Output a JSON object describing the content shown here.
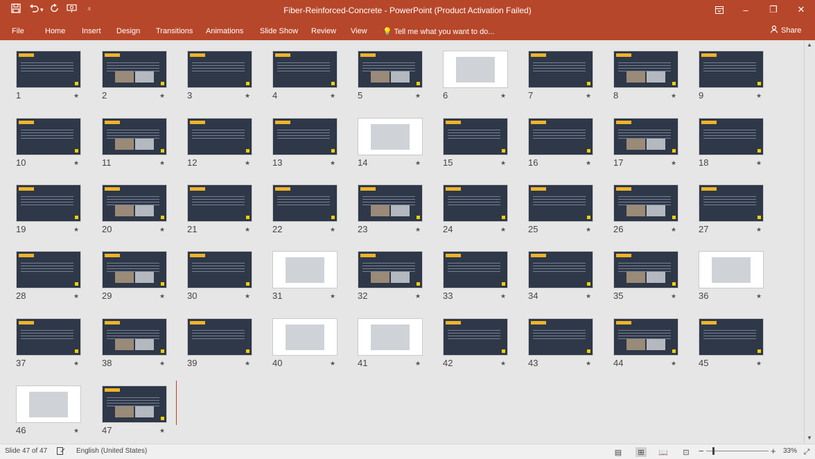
{
  "app": {
    "window_title": "Fiber-Reinforced-Concrete - PowerPoint (Product Activation Failed)",
    "colors": {
      "ribbon": "#b7472a",
      "slide_dark": "#2f3848",
      "accent": "#f0b429"
    }
  },
  "qat": {
    "save_icon": "save-icon",
    "undo_icon": "undo-icon",
    "redo_icon": "redo-icon",
    "present_icon": "present-from-start-icon",
    "customize_icon": "customize-qat-icon"
  },
  "window_controls": {
    "ribbon_options_icon": "ribbon-display-options-icon",
    "minimize_label": "–",
    "restore_label": "❐",
    "close_label": "✕"
  },
  "ribbon": {
    "tabs": [
      "File",
      "Home",
      "Insert",
      "Design",
      "Transitions",
      "Animations",
      "Slide Show",
      "Review",
      "View"
    ],
    "tell_me": "Tell me what you want to do...",
    "share": "Share"
  },
  "slides": [
    {
      "n": "1",
      "light": false
    },
    {
      "n": "2",
      "light": false
    },
    {
      "n": "3",
      "light": false
    },
    {
      "n": "4",
      "light": false
    },
    {
      "n": "5",
      "light": false
    },
    {
      "n": "6",
      "light": true
    },
    {
      "n": "7",
      "light": false
    },
    {
      "n": "8",
      "light": false
    },
    {
      "n": "9",
      "light": false
    },
    {
      "n": "10",
      "light": false
    },
    {
      "n": "11",
      "light": false
    },
    {
      "n": "12",
      "light": false
    },
    {
      "n": "13",
      "light": false
    },
    {
      "n": "14",
      "light": true
    },
    {
      "n": "15",
      "light": false
    },
    {
      "n": "16",
      "light": false
    },
    {
      "n": "17",
      "light": false
    },
    {
      "n": "18",
      "light": false
    },
    {
      "n": "19",
      "light": false
    },
    {
      "n": "20",
      "light": false
    },
    {
      "n": "21",
      "light": false
    },
    {
      "n": "22",
      "light": false
    },
    {
      "n": "23",
      "light": false
    },
    {
      "n": "24",
      "light": false
    },
    {
      "n": "25",
      "light": false
    },
    {
      "n": "26",
      "light": false
    },
    {
      "n": "27",
      "light": false
    },
    {
      "n": "28",
      "light": false
    },
    {
      "n": "29",
      "light": false
    },
    {
      "n": "30",
      "light": false
    },
    {
      "n": "31",
      "light": true
    },
    {
      "n": "32",
      "light": false
    },
    {
      "n": "33",
      "light": false
    },
    {
      "n": "34",
      "light": false
    },
    {
      "n": "35",
      "light": false
    },
    {
      "n": "36",
      "light": true
    },
    {
      "n": "37",
      "light": false
    },
    {
      "n": "38",
      "light": false
    },
    {
      "n": "39",
      "light": false
    },
    {
      "n": "40",
      "light": true
    },
    {
      "n": "41",
      "light": true
    },
    {
      "n": "42",
      "light": false
    },
    {
      "n": "43",
      "light": false
    },
    {
      "n": "44",
      "light": false
    },
    {
      "n": "45",
      "light": false
    },
    {
      "n": "46",
      "light": true
    },
    {
      "n": "47",
      "light": false
    }
  ],
  "status": {
    "slide_info": "Slide 47 of 47",
    "language": "English (United States)",
    "zoom": "33%",
    "zoom_out": "−",
    "zoom_in": "+"
  }
}
